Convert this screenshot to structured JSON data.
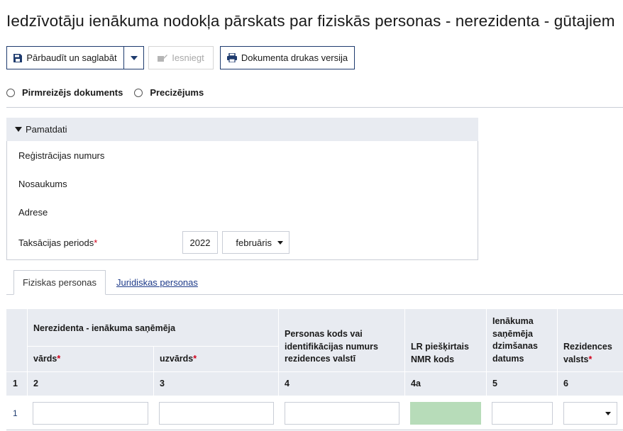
{
  "page": {
    "title": "Iedzīvotāju ienākuma nodokļa pārskats par fiziskās personas - nerezidenta - gūtajiem"
  },
  "toolbar": {
    "save_label": "Pārbaudīt un saglabāt",
    "submit_label": "Iesniegt",
    "print_label": "Dokumenta drukas versija",
    "submit_disabled": true
  },
  "doc_type": {
    "options": [
      "Pirmreizējs dokuments",
      "Precizējums"
    ]
  },
  "panel": {
    "title": "Pamatdati",
    "fields": {
      "reg_number": "Reģistrācijas numurs",
      "name": "Nosaukums",
      "address": "Adrese",
      "tax_period": "Taksācijas periods",
      "required_mark": "*"
    },
    "tax_period_year": "2022",
    "tax_period_month": "februāris"
  },
  "tabs": [
    "Fiziskas personas",
    "Juridiskas personas"
  ],
  "table": {
    "group_header": "Nerezidenta - ienākuma saņēmēja",
    "col_first_name": "vārds",
    "col_last_name": "uzvārds",
    "col_person_code": "Personas kods vai identifikācijas numurs rezidences valstī",
    "col_nmr": "LR piešķirtais NMR kods",
    "col_birth": "Ienākuma saņēmēja dzimšanas datums",
    "col_country": "Rezidences valsts",
    "col_numbers": [
      "1",
      "2",
      "3",
      "4",
      "4a",
      "5",
      "6"
    ],
    "row_numbers": [
      "1"
    ]
  },
  "colors": {
    "accent": "#1e3b6e",
    "header_bg": "#e8ebf1",
    "nmr_field": "#b7dcb9",
    "required": "#d0021b",
    "link": "#1e3b8a"
  }
}
